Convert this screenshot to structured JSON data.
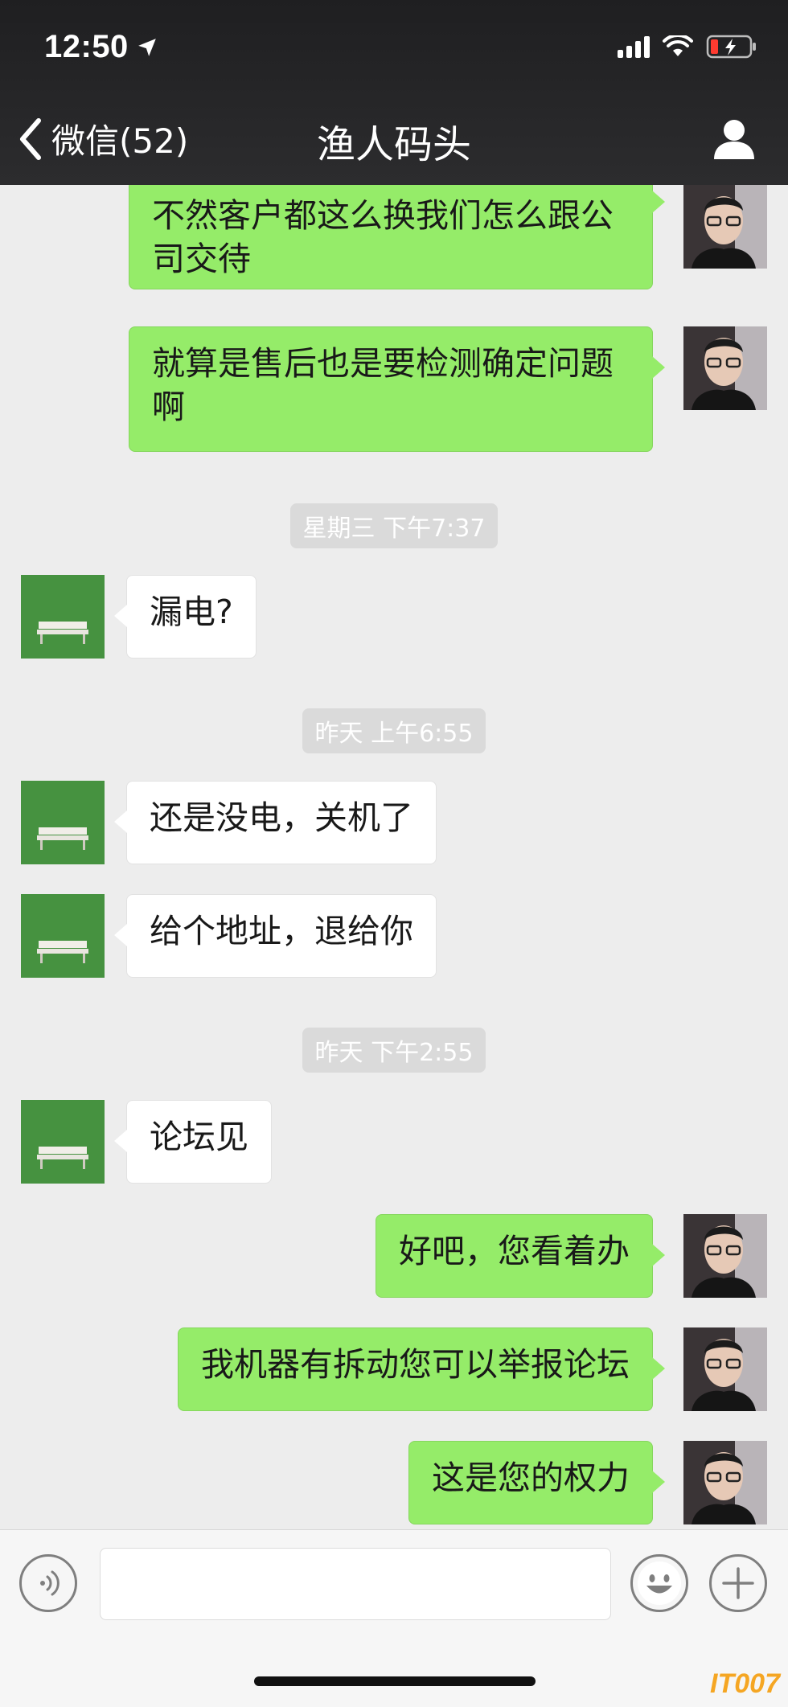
{
  "status_bar": {
    "time": "12:50"
  },
  "nav": {
    "back_label": "微信(52)",
    "title": "渔人码头"
  },
  "messages": [
    {
      "side": "me",
      "text_lines": [
        "不然客户都这么换我们怎么跟公",
        "司交待"
      ]
    },
    {
      "side": "me",
      "text_lines": [
        "就算是售后也是要检测确定问题",
        "啊"
      ]
    },
    {
      "timestamp": "星期三 下午7:37"
    },
    {
      "side": "other",
      "text": "漏电?"
    },
    {
      "timestamp": "昨天 上午6:55"
    },
    {
      "side": "other",
      "text": "还是没电，关机了"
    },
    {
      "side": "other",
      "text": "给个地址，退给你"
    },
    {
      "timestamp": "昨天 下午2:55"
    },
    {
      "side": "other",
      "text": "论坛见"
    },
    {
      "side": "me",
      "text": "好吧，您看着办"
    },
    {
      "side": "me",
      "text": "我机器有拆动您可以举报论坛"
    },
    {
      "side": "me",
      "text": "这是您的权力"
    }
  ],
  "input": {
    "value": ""
  },
  "icons": {
    "back": "chevron-left-icon",
    "profile": "person-icon",
    "voice": "voice-icon",
    "emoji": "emoji-icon",
    "more": "plus-icon",
    "location": "location-arrow-icon",
    "wifi": "wifi-icon",
    "battery": "battery-icon",
    "signal": "signal-icon"
  },
  "colors": {
    "my_bubble": "#95ec69",
    "other_bubble": "#ffffff",
    "chat_background": "#ededed",
    "nav_background": "#2c2c2e",
    "battery_low": "#ff3b30"
  },
  "watermark": "IT007"
}
